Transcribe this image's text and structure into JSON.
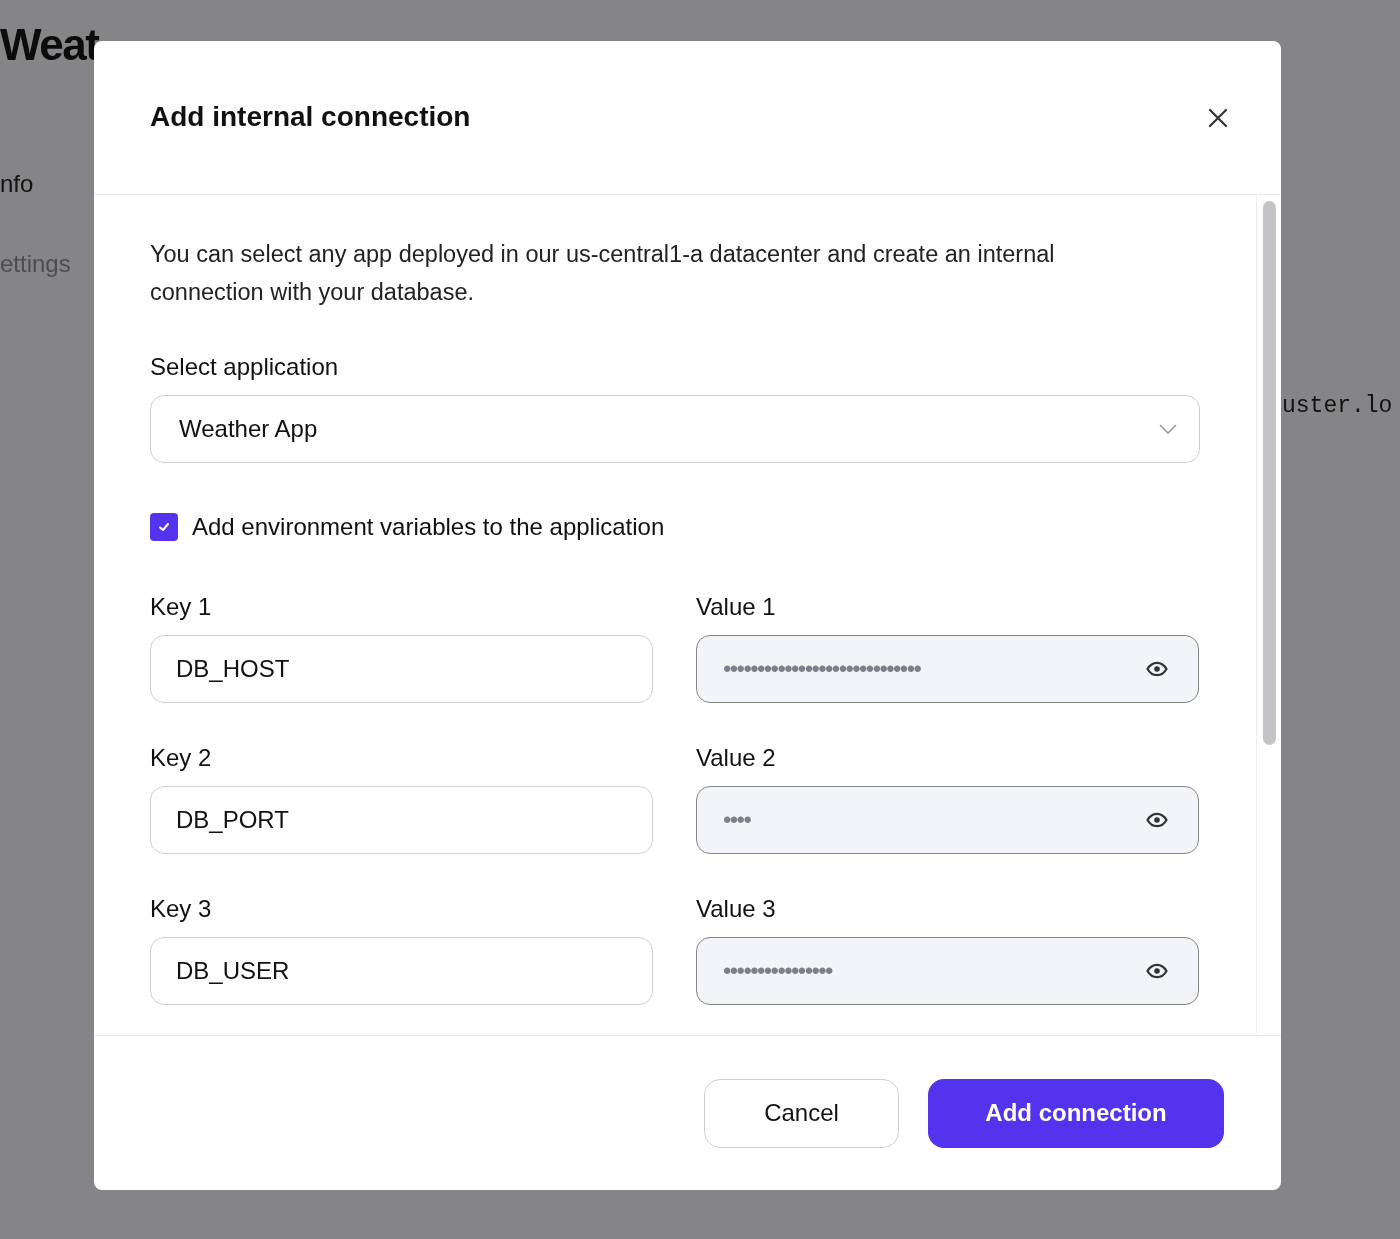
{
  "background": {
    "title": "Weat",
    "nav_items": [
      {
        "label": "nfo",
        "selected": true
      },
      {
        "label": "ettings",
        "selected": false
      }
    ],
    "code_text": "uster.lo"
  },
  "dialog": {
    "title": "Add internal connection",
    "description": "You can select any app deployed in our us-central1-a datacenter and create an internal connection with your database.",
    "select": {
      "label": "Select application",
      "value": "Weather App"
    },
    "env_checkbox": {
      "label": "Add environment variables to the application",
      "checked": true
    },
    "variables": [
      {
        "key_label": "Key 1",
        "key": "DB_HOST",
        "value_label": "Value 1",
        "value": "•••••••••••••••••••••••••••••"
      },
      {
        "key_label": "Key 2",
        "key": "DB_PORT",
        "value_label": "Value 2",
        "value": "••••"
      },
      {
        "key_label": "Key 3",
        "key": "DB_USER",
        "value_label": "Value 3",
        "value": "••••••••••••••••"
      }
    ],
    "buttons": [
      {
        "label": "Cancel",
        "kind": "secondary"
      },
      {
        "label": "Add connection",
        "kind": "primary"
      }
    ]
  }
}
